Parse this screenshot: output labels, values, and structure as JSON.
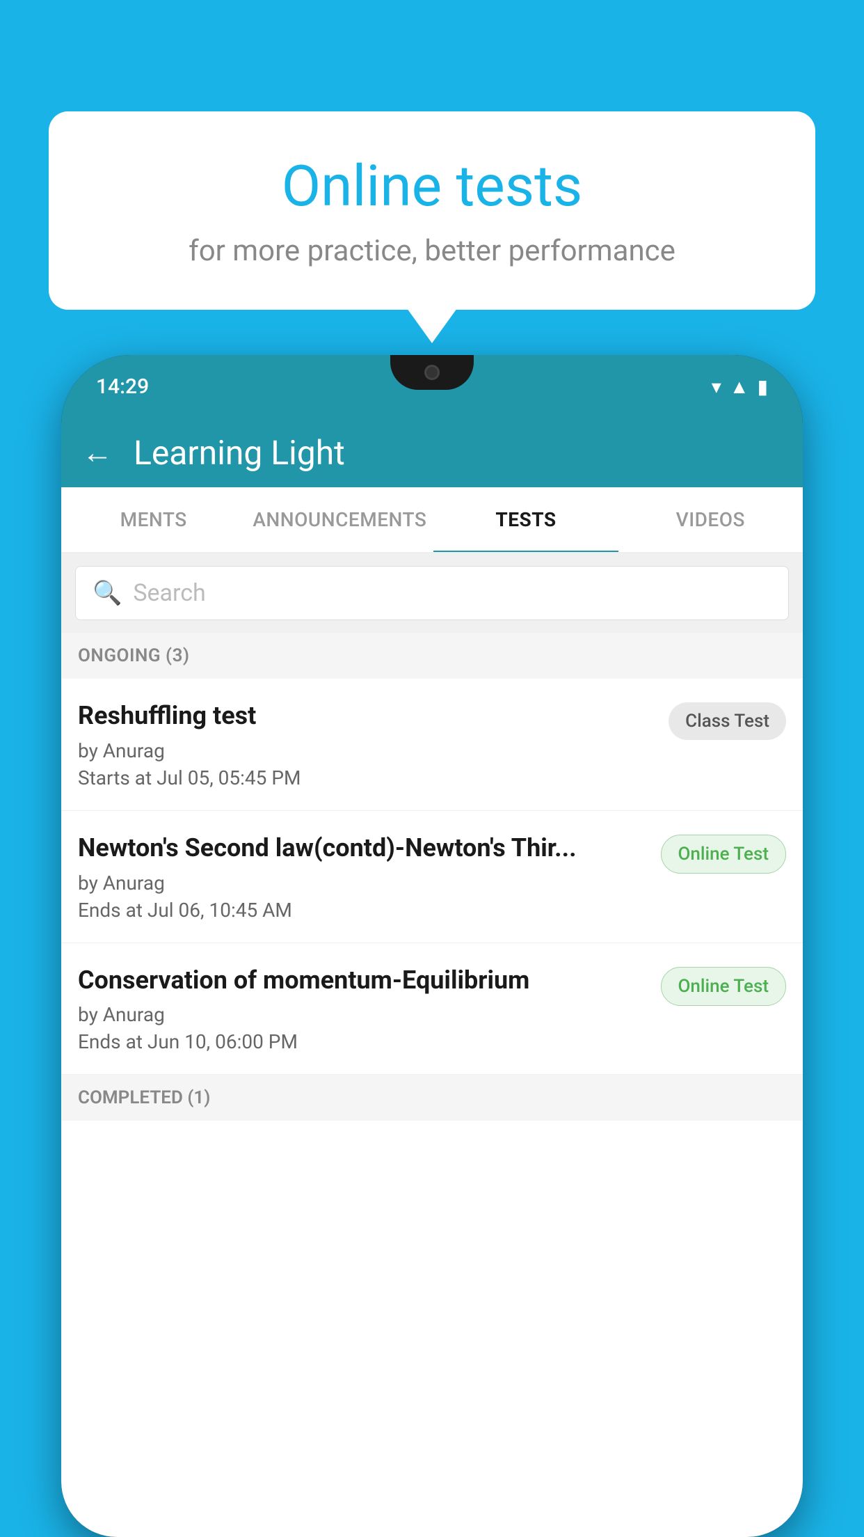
{
  "background_color": "#1ab3e8",
  "speech_bubble": {
    "title": "Online tests",
    "subtitle": "for more practice, better performance"
  },
  "phone": {
    "status_bar": {
      "time": "14:29",
      "icons": [
        "wifi",
        "signal",
        "battery"
      ]
    },
    "app_header": {
      "back_label": "←",
      "title": "Learning Light"
    },
    "tabs": [
      {
        "label": "MENTS",
        "active": false
      },
      {
        "label": "ANNOUNCEMENTS",
        "active": false
      },
      {
        "label": "TESTS",
        "active": true
      },
      {
        "label": "VIDEOS",
        "active": false
      }
    ],
    "search": {
      "placeholder": "Search"
    },
    "ongoing_section": {
      "label": "ONGOING (3)",
      "items": [
        {
          "title": "Reshuffling test",
          "author": "by Anurag",
          "date": "Starts at  Jul 05, 05:45 PM",
          "badge": "Class Test",
          "badge_type": "class"
        },
        {
          "title": "Newton's Second law(contd)-Newton's Thir...",
          "author": "by Anurag",
          "date": "Ends at  Jul 06, 10:45 AM",
          "badge": "Online Test",
          "badge_type": "online"
        },
        {
          "title": "Conservation of momentum-Equilibrium",
          "author": "by Anurag",
          "date": "Ends at  Jun 10, 06:00 PM",
          "badge": "Online Test",
          "badge_type": "online"
        }
      ]
    },
    "completed_section": {
      "label": "COMPLETED (1)"
    }
  }
}
